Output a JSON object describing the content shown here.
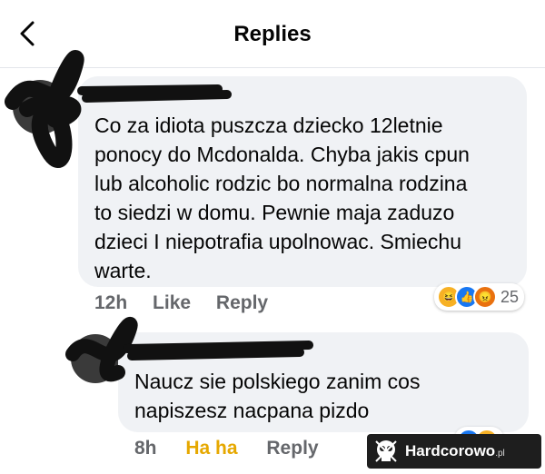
{
  "header": {
    "title": "Replies"
  },
  "comments": [
    {
      "text": "Co za idiota puszcza dziecko 12letnie\nponocy do Mcdonalda. Chyba jakis cpun\nlub alcoholic rodzic bo normalna rodzina\nto siedzi w domu. Pewnie maja zaduzo\ndzieci I niepotrafia upolnowac. Smiechu\nwarte.",
      "time": "12h",
      "like_label": "Like",
      "reply_label": "Reply",
      "reactions": [
        "haha-icon",
        "like-icon",
        "angry-icon"
      ],
      "reaction_count": "25"
    },
    {
      "text": "Naucz sie polskiego zanim cos\nnapiszesz nacpana pizdo",
      "time": "8h",
      "reaction_label": "Ha ha",
      "reply_label": "Reply"
    }
  ],
  "watermark": {
    "brand": "Hardcorowo",
    "suffix": ".pl"
  },
  "colors": {
    "bubble": "#f0f2f5",
    "meta": "#65676b",
    "haha": "#e6a800",
    "like_blue": "#1877f2",
    "angry_red": "#e9710f"
  }
}
